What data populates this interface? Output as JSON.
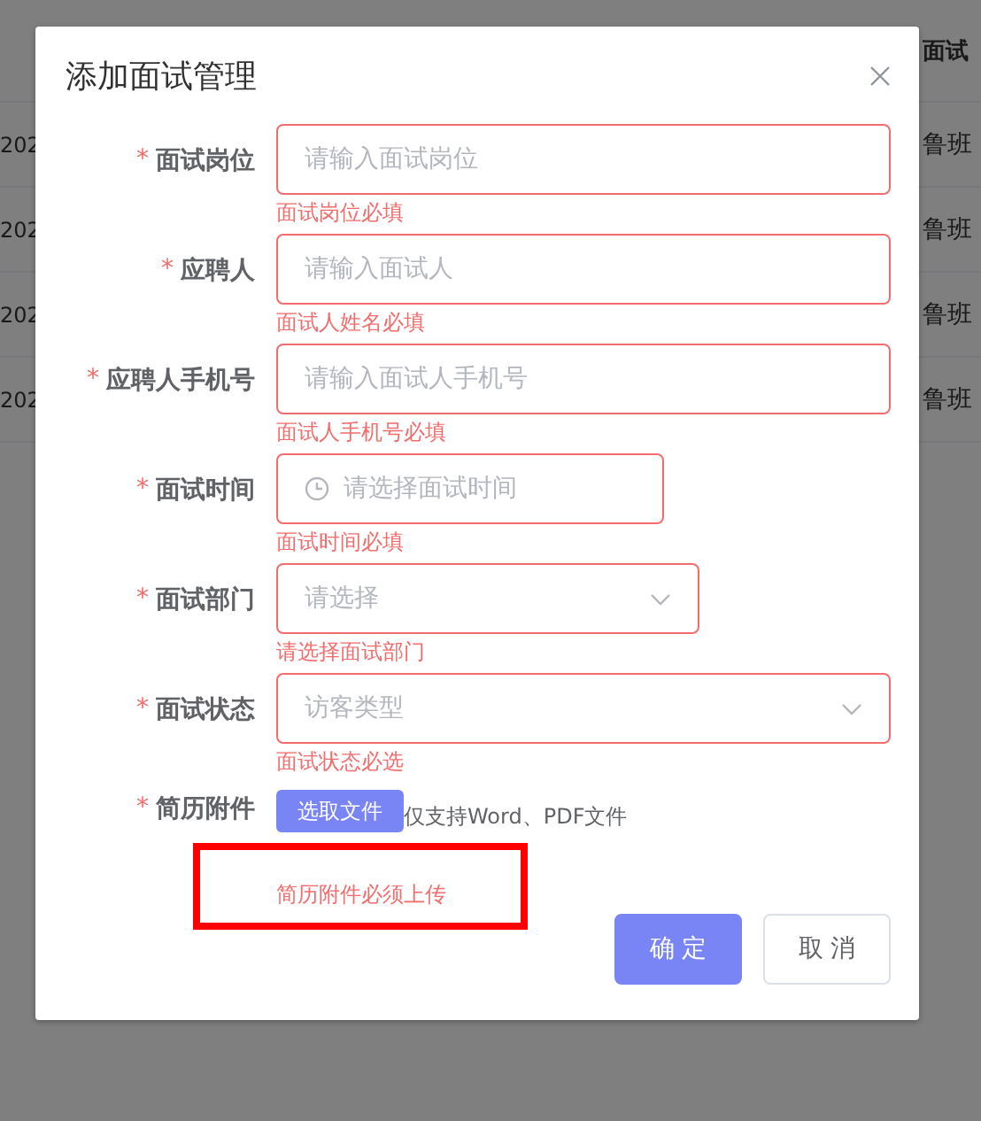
{
  "background_table": {
    "header": {
      "column_2": "面试"
    },
    "rows": [
      {
        "column_1": "202",
        "column_2": "鲁班"
      },
      {
        "column_1": "202",
        "column_2": "鲁班"
      },
      {
        "column_1": "202",
        "column_2": "鲁班"
      },
      {
        "column_1": "202",
        "column_2": "鲁班"
      }
    ]
  },
  "dialog": {
    "title": "添加面试管理",
    "fields": [
      {
        "kind": "text",
        "required_mark": "*",
        "label": "面试岗位",
        "placeholder": "请输入面试岗位",
        "invalid": true,
        "error": "面试岗位必填"
      },
      {
        "kind": "text",
        "required_mark": "*",
        "label": "应聘人",
        "placeholder": "请输入面试人",
        "invalid": true,
        "error": "面试人姓名必填"
      },
      {
        "kind": "text",
        "required_mark": "*",
        "label": "应聘人手机号",
        "placeholder": "请输入面试人手机号",
        "invalid": true,
        "error": "面试人手机号必填"
      },
      {
        "kind": "time",
        "required_mark": "*",
        "label": "面试时间",
        "placeholder": "请选择面试时间",
        "invalid": true,
        "error": "面试时间必填"
      },
      {
        "kind": "select",
        "required_mark": "*",
        "label": "面试部门",
        "placeholder": "请选择",
        "invalid": true,
        "error": "请选择面试部门"
      },
      {
        "kind": "select",
        "required_mark": "*",
        "label": "面试状态",
        "placeholder": "访客类型",
        "invalid": true,
        "error": "面试状态必选"
      },
      {
        "kind": "upload",
        "required_mark": "*",
        "label": "简历附件",
        "button": "选取文件",
        "hint": "仅支持Word、PDF文件",
        "error": "简历附件必须上传",
        "highlighted": true
      }
    ],
    "buttons": [
      {
        "kind": "primary",
        "label": "确 定"
      },
      {
        "kind": "default",
        "label": "取 消"
      }
    ]
  }
}
